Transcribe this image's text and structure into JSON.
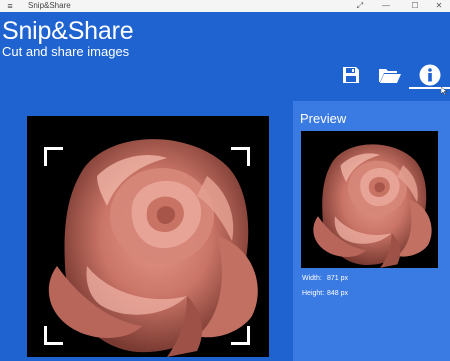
{
  "titlebar": {
    "menu_icon": "hamburger-icon",
    "title": "Snip&Share",
    "controls": [
      "expand-icon",
      "minimize-icon",
      "maximize-icon",
      "close-icon"
    ]
  },
  "header": {
    "title": "Snip&Share",
    "subtitle": "Cut and share images"
  },
  "toolbar": {
    "buttons": [
      {
        "name": "save",
        "icon": "floppy-disk-icon"
      },
      {
        "name": "open",
        "icon": "folder-open-icon"
      },
      {
        "name": "info",
        "icon": "info-icon",
        "active": true
      }
    ]
  },
  "main": {
    "image": "rose-image",
    "selection_handles": [
      "top-left",
      "top-right",
      "bottom-left",
      "bottom-right"
    ]
  },
  "preview": {
    "title": "Preview",
    "width_label": "Width:",
    "width_value": "871 px",
    "height_label": "Height:",
    "height_value": "848 px"
  },
  "colors": {
    "background": "#1f63d0",
    "preview_panel": "#3a7ae3",
    "titlebar": "#f5f5f5",
    "accent": "#ffffff"
  }
}
